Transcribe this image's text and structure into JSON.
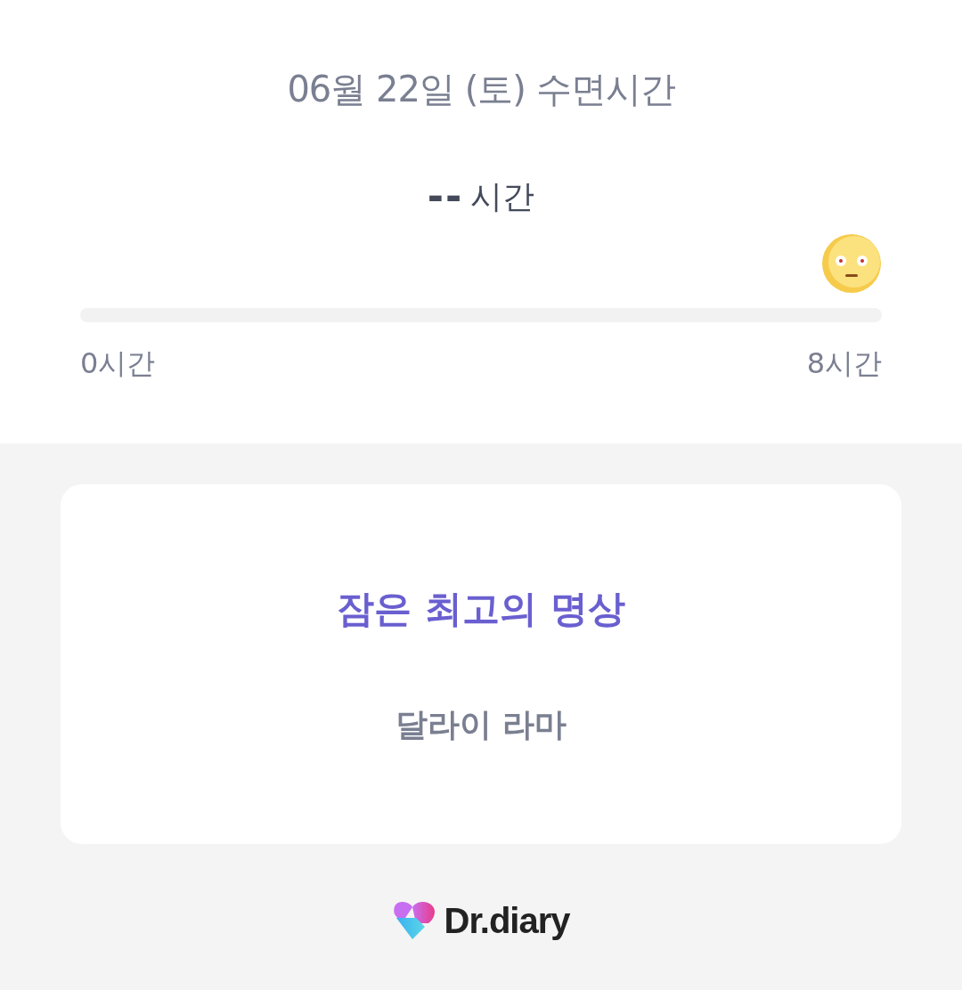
{
  "header": {
    "title": "06월 22일 (토) 수면시간",
    "duration_value": "--",
    "duration_unit": "시간"
  },
  "sleep_bar": {
    "level": 0,
    "min_label": "0시간",
    "max_label": "8시간"
  },
  "quote_card": {
    "quote": "잠은 최고의 명상",
    "author": "달라이 라마"
  },
  "brand": {
    "name": "Dr.diary"
  }
}
